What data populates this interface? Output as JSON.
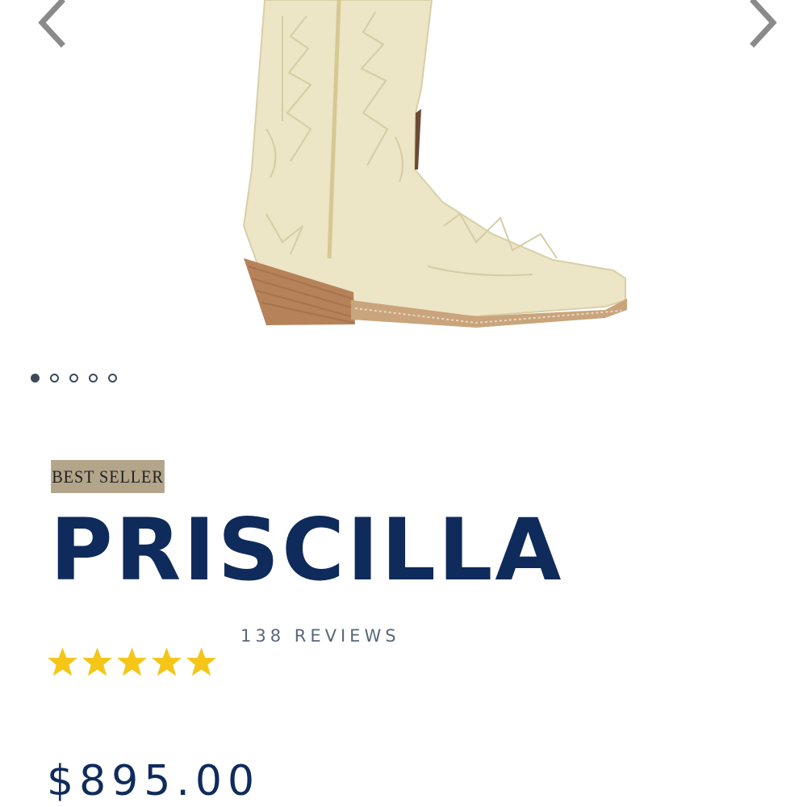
{
  "gallery": {
    "prev_icon": "chevron-left-icon",
    "next_icon": "chevron-right-icon",
    "image": "cowboy-boot-image",
    "slide_count": 5,
    "active_slide": 1
  },
  "product": {
    "badge": "BEST SELLER",
    "name": "PRISCILLA",
    "reviews": "138 REVIEWS",
    "rating": 5,
    "rating_max": 5,
    "price": "$895.00"
  },
  "colors": {
    "title": "#0f2b5b",
    "badge_bg": "#b3a58a",
    "star": "#f5c518",
    "boot": "#ece5c6"
  }
}
